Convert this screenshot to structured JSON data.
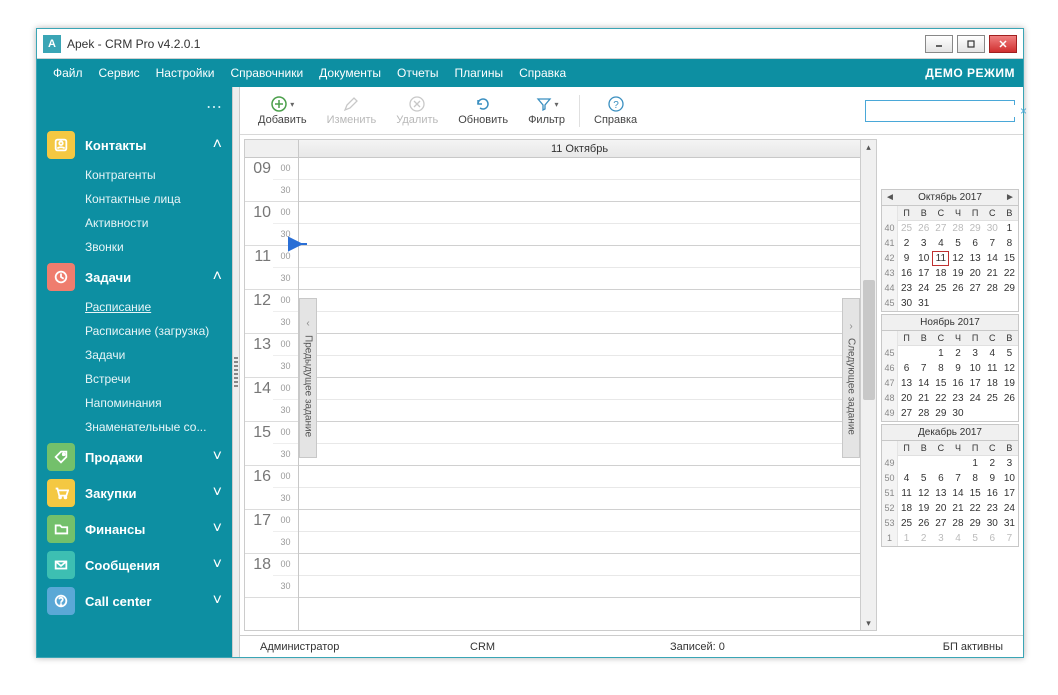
{
  "window": {
    "title": "Apek - CRM Pro v4.2.0.1",
    "icon_letter": "A"
  },
  "menu": {
    "items": [
      "Файл",
      "Сервис",
      "Настройки",
      "Справочники",
      "Документы",
      "Отчеты",
      "Плагины",
      "Справка"
    ],
    "demo": "ДЕМО РЕЖИМ"
  },
  "sidebar": {
    "sections": [
      {
        "label": "Контакты",
        "expanded": true,
        "icon": "contact-icon",
        "color": "ic-yellow",
        "items": [
          "Контрагенты",
          "Контактные лица",
          "Активности",
          "Звонки"
        ],
        "active": -1
      },
      {
        "label": "Задачи",
        "expanded": true,
        "icon": "clock-icon",
        "color": "ic-coral",
        "items": [
          "Расписание",
          "Расписание (загрузка)",
          "Задачи",
          "Встречи",
          "Напоминания",
          "Знаменательные со..."
        ],
        "active": 0
      },
      {
        "label": "Продажи",
        "expanded": false,
        "icon": "tag-icon",
        "color": "ic-green"
      },
      {
        "label": "Закупки",
        "expanded": false,
        "icon": "cart-icon",
        "color": "ic-yellow2"
      },
      {
        "label": "Финансы",
        "expanded": false,
        "icon": "folder-icon",
        "color": "ic-green2"
      },
      {
        "label": "Сообщения",
        "expanded": false,
        "icon": "mail-icon",
        "color": "ic-teal"
      },
      {
        "label": "Call center",
        "expanded": false,
        "icon": "help-icon",
        "color": "ic-blue"
      }
    ]
  },
  "toolbar": {
    "add": "Добавить",
    "edit": "Изменить",
    "delete": "Удалить",
    "refresh": "Обновить",
    "filter": "Фильтр",
    "help": "Справка"
  },
  "search": {
    "placeholder": ""
  },
  "schedule": {
    "day_header": "11 Октябрь",
    "hours": [
      "09",
      "10",
      "11",
      "12",
      "13",
      "14",
      "15",
      "16",
      "17",
      "18"
    ],
    "halves": [
      "00",
      "30"
    ],
    "prev_label": "Предыдущее задание",
    "next_label": "Следующее задание"
  },
  "mini_calendars": [
    {
      "title": "Октябрь 2017",
      "show_nav": true,
      "dow": [
        "П",
        "В",
        "С",
        "Ч",
        "П",
        "С",
        "В"
      ],
      "weeks": [
        {
          "wk": "40",
          "days": [
            [
              "25",
              1
            ],
            [
              "26",
              1
            ],
            [
              "27",
              1
            ],
            [
              "28",
              1
            ],
            [
              "29",
              1
            ],
            [
              "30",
              1
            ],
            [
              "1",
              0
            ]
          ]
        },
        {
          "wk": "41",
          "days": [
            [
              "2",
              0
            ],
            [
              "3",
              0
            ],
            [
              "4",
              0
            ],
            [
              "5",
              0
            ],
            [
              "6",
              0
            ],
            [
              "7",
              0
            ],
            [
              "8",
              0
            ]
          ]
        },
        {
          "wk": "42",
          "days": [
            [
              "9",
              0
            ],
            [
              "10",
              0
            ],
            [
              "11",
              2
            ],
            [
              "12",
              0
            ],
            [
              "13",
              0
            ],
            [
              "14",
              0
            ],
            [
              "15",
              0
            ]
          ]
        },
        {
          "wk": "43",
          "days": [
            [
              "16",
              0
            ],
            [
              "17",
              0
            ],
            [
              "18",
              0
            ],
            [
              "19",
              0
            ],
            [
              "20",
              0
            ],
            [
              "21",
              0
            ],
            [
              "22",
              0
            ]
          ]
        },
        {
          "wk": "44",
          "days": [
            [
              "23",
              0
            ],
            [
              "24",
              0
            ],
            [
              "25",
              0
            ],
            [
              "26",
              0
            ],
            [
              "27",
              0
            ],
            [
              "28",
              0
            ],
            [
              "29",
              0
            ]
          ]
        },
        {
          "wk": "45",
          "days": [
            [
              "30",
              0
            ],
            [
              "31",
              0
            ],
            [
              "",
              0
            ],
            [
              "",
              0
            ],
            [
              "",
              0
            ],
            [
              "",
              0
            ],
            [
              "",
              0
            ]
          ]
        }
      ]
    },
    {
      "title": "Ноябрь 2017",
      "show_nav": false,
      "dow": [
        "П",
        "В",
        "С",
        "Ч",
        "П",
        "С",
        "В"
      ],
      "weeks": [
        {
          "wk": "45",
          "days": [
            [
              "",
              0
            ],
            [
              "",
              0
            ],
            [
              "1",
              0
            ],
            [
              "2",
              0
            ],
            [
              "3",
              0
            ],
            [
              "4",
              0
            ],
            [
              "5",
              0
            ]
          ]
        },
        {
          "wk": "46",
          "days": [
            [
              "6",
              0
            ],
            [
              "7",
              0
            ],
            [
              "8",
              0
            ],
            [
              "9",
              0
            ],
            [
              "10",
              0
            ],
            [
              "11",
              0
            ],
            [
              "12",
              0
            ]
          ]
        },
        {
          "wk": "47",
          "days": [
            [
              "13",
              0
            ],
            [
              "14",
              0
            ],
            [
              "15",
              0
            ],
            [
              "16",
              0
            ],
            [
              "17",
              0
            ],
            [
              "18",
              0
            ],
            [
              "19",
              0
            ]
          ]
        },
        {
          "wk": "48",
          "days": [
            [
              "20",
              0
            ],
            [
              "21",
              0
            ],
            [
              "22",
              0
            ],
            [
              "23",
              0
            ],
            [
              "24",
              0
            ],
            [
              "25",
              0
            ],
            [
              "26",
              0
            ]
          ]
        },
        {
          "wk": "49",
          "days": [
            [
              "27",
              0
            ],
            [
              "28",
              0
            ],
            [
              "29",
              0
            ],
            [
              "30",
              0
            ],
            [
              "",
              0
            ],
            [
              "",
              0
            ],
            [
              "",
              0
            ]
          ]
        }
      ]
    },
    {
      "title": "Декабрь 2017",
      "show_nav": false,
      "dow": [
        "П",
        "В",
        "С",
        "Ч",
        "П",
        "С",
        "В"
      ],
      "weeks": [
        {
          "wk": "49",
          "days": [
            [
              "",
              0
            ],
            [
              "",
              0
            ],
            [
              "",
              0
            ],
            [
              "",
              0
            ],
            [
              "1",
              0
            ],
            [
              "2",
              0
            ],
            [
              "3",
              0
            ]
          ]
        },
        {
          "wk": "50",
          "days": [
            [
              "4",
              0
            ],
            [
              "5",
              0
            ],
            [
              "6",
              0
            ],
            [
              "7",
              0
            ],
            [
              "8",
              0
            ],
            [
              "9",
              0
            ],
            [
              "10",
              0
            ]
          ]
        },
        {
          "wk": "51",
          "days": [
            [
              "11",
              0
            ],
            [
              "12",
              0
            ],
            [
              "13",
              0
            ],
            [
              "14",
              0
            ],
            [
              "15",
              0
            ],
            [
              "16",
              0
            ],
            [
              "17",
              0
            ]
          ]
        },
        {
          "wk": "52",
          "days": [
            [
              "18",
              0
            ],
            [
              "19",
              0
            ],
            [
              "20",
              0
            ],
            [
              "21",
              0
            ],
            [
              "22",
              0
            ],
            [
              "23",
              0
            ],
            [
              "24",
              0
            ]
          ]
        },
        {
          "wk": "53",
          "days": [
            [
              "25",
              0
            ],
            [
              "26",
              0
            ],
            [
              "27",
              0
            ],
            [
              "28",
              0
            ],
            [
              "29",
              0
            ],
            [
              "30",
              0
            ],
            [
              "31",
              0
            ]
          ]
        },
        {
          "wk": "1",
          "days": [
            [
              "1",
              1
            ],
            [
              "2",
              1
            ],
            [
              "3",
              1
            ],
            [
              "4",
              1
            ],
            [
              "5",
              1
            ],
            [
              "6",
              1
            ],
            [
              "7",
              1
            ]
          ]
        }
      ]
    }
  ],
  "status": {
    "user": "Администратор",
    "db": "CRM",
    "records": "Записей: 0",
    "bp": "БП активны"
  }
}
